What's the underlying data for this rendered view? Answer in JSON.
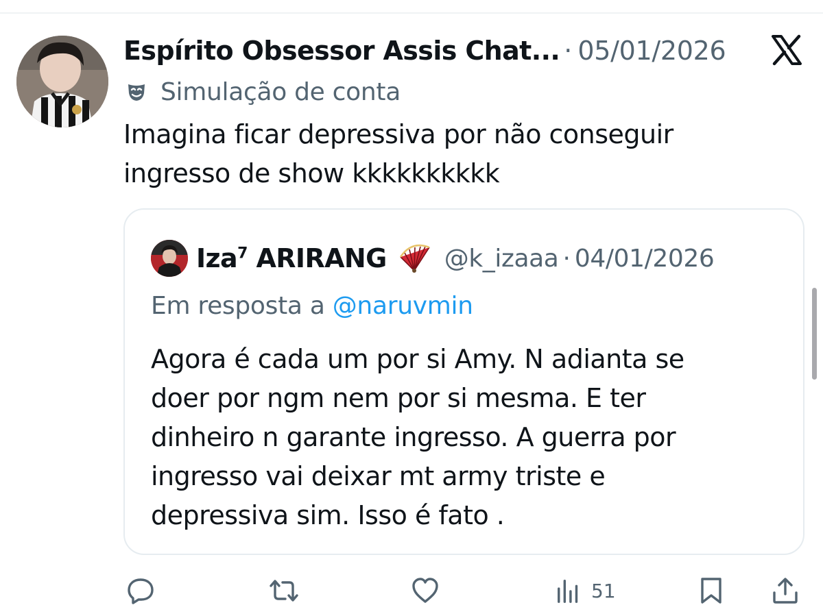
{
  "post": {
    "author_name": "Espírito Obsessor Assis Chat...",
    "separator": "·",
    "date": "05/01/2026",
    "account_label": "Simulação de conta",
    "text": "Imagina ficar depressiva por não conseguir\ningresso de show kkkkkkkkkk"
  },
  "quote": {
    "name": "Iza",
    "name_sup": "7",
    "name_rest": " ARIRANG",
    "handle": "@k_izaaa",
    "separator": "·",
    "date": "04/01/2026",
    "reply_prefix": "Em resposta a ",
    "reply_handle": "@naruvmin",
    "text": "Agora é cada um por si Amy. N adianta se\ndoer por ngm nem por si mesma. E ter\ndinheiro n garante ingresso.  A guerra por\ningresso vai deixar mt army triste e\ndepressiva sim. Isso é fato ."
  },
  "actions": {
    "views_count": "51"
  },
  "icons": [
    "x-logo-icon",
    "mask-icon",
    "fan-emoji-icon",
    "reply-icon",
    "retweet-icon",
    "like-icon",
    "views-icon",
    "bookmark-icon",
    "share-icon"
  ],
  "colors": {
    "text": "#0f1419",
    "muted": "#536471",
    "link": "#1d9bf0",
    "border": "#e6ecf0"
  }
}
